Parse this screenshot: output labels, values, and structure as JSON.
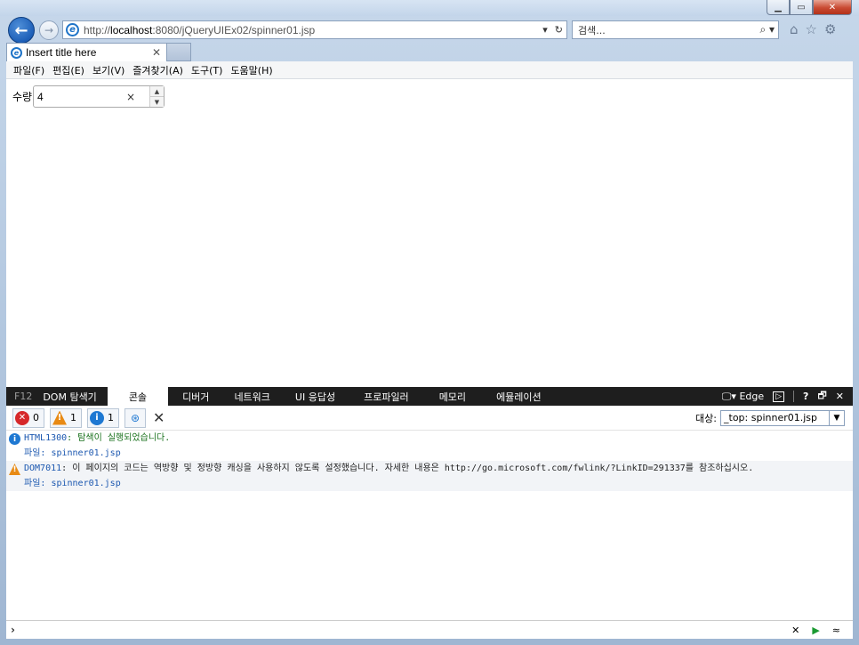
{
  "window": {
    "min_icon": "minimize-icon",
    "max_icon": "maximize-icon",
    "close_icon": "close-icon"
  },
  "nav": {
    "url_prefix": "http://",
    "url_host": "localhost",
    "url_rest": ":8080/jQueryUIEx02/spinner01.jsp",
    "search_placeholder": "검색...",
    "refresh_glyph": "↻"
  },
  "tab": {
    "title": "Insert title here"
  },
  "menu": [
    "파일(F)",
    "편집(E)",
    "보기(V)",
    "즐겨찾기(A)",
    "도구(T)",
    "도움말(H)"
  ],
  "page": {
    "qty_label": "수량",
    "qty_value": "4"
  },
  "devtools": {
    "f12": "F12",
    "tabs": [
      "DOM 탐색기",
      "콘솔",
      "디버거",
      "네트워크",
      "UI 응답성",
      "프로파일러",
      "메모리",
      "에뮬레이션"
    ],
    "active_tab": 1,
    "mode": "Edge",
    "errors": "0",
    "warnings": "1",
    "infos": "1",
    "target_label": "대상:",
    "target_value": "_top: spinner01.jsp",
    "messages": [
      {
        "type": "info",
        "code": "HTML1300",
        "text": ": 탐색이 실행되었습니다.",
        "file_label": "파일: ",
        "file": "spinner01.jsp"
      },
      {
        "type": "warn",
        "code": "DOM7011",
        "text": ": 이 페이지의 코드는 역방향 및 정방향 캐싱을 사용하지 않도록 설정했습니다. 자세한 내용은 http://go.microsoft.com/fwlink/?LinkID=291337를 참조하십시오.",
        "file_label": "파일: ",
        "file": "spinner01.jsp"
      }
    ]
  }
}
